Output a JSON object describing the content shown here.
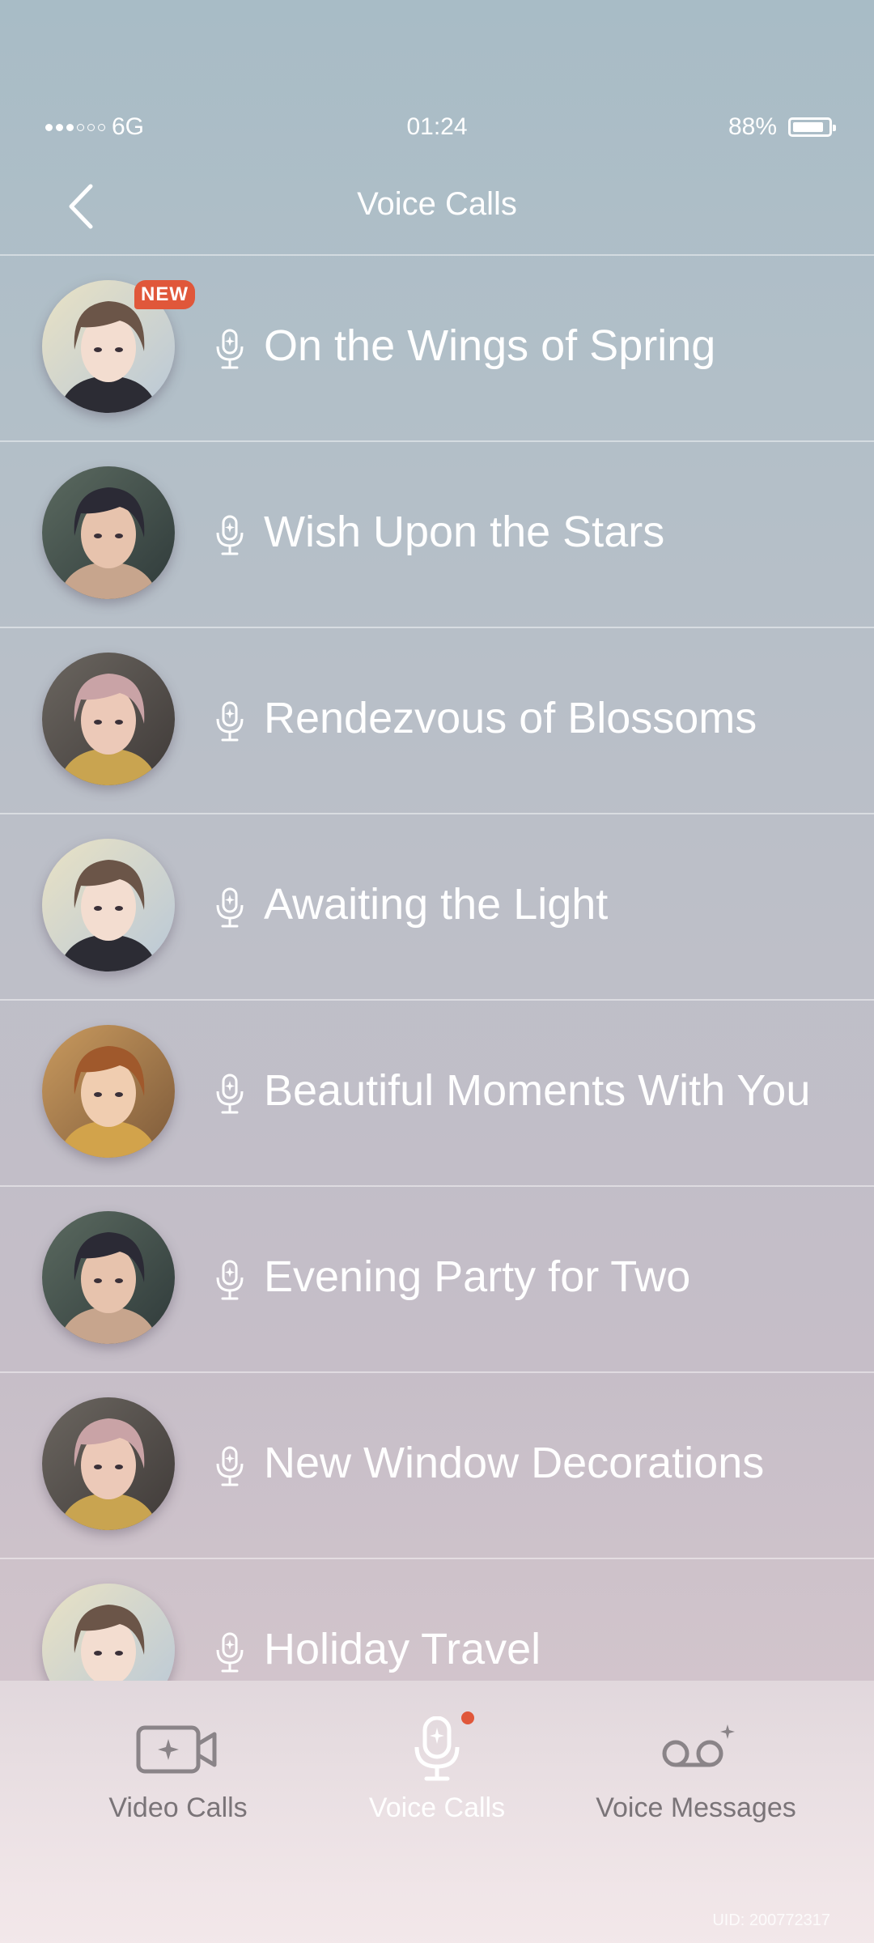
{
  "status": {
    "carrier": "6G",
    "time": "01:24",
    "battery": "88%",
    "battery_level": 0.88
  },
  "header": {
    "title": "Voice Calls"
  },
  "calls": [
    {
      "title": "On the Wings of Spring",
      "badge": "NEW",
      "character": "brown-hair-suit"
    },
    {
      "title": "Wish Upon the Stars",
      "character": "dark-hair"
    },
    {
      "title": "Rendezvous of Blossoms",
      "character": "pink-hair"
    },
    {
      "title": "Awaiting the Light",
      "character": "brown-hair-suit"
    },
    {
      "title": "Beautiful Moments With You",
      "character": "auburn-hair"
    },
    {
      "title": "Evening Party for Two",
      "character": "dark-hair"
    },
    {
      "title": "New Window Decorations",
      "character": "pink-hair"
    },
    {
      "title": "Holiday Travel",
      "character": "brown-hair-suit"
    }
  ],
  "nav": [
    {
      "label": "Video Calls",
      "icon": "video-camera-icon"
    },
    {
      "label": "Voice Calls",
      "icon": "microphone-icon",
      "active": true,
      "notification_dot": true
    },
    {
      "label": "Voice Messages",
      "icon": "voicemail-icon"
    }
  ],
  "uid": "UID: 200772317",
  "colors": {
    "accent": "#e0573a",
    "text": "#ffffff",
    "nav_inactive": "#7a7478"
  }
}
